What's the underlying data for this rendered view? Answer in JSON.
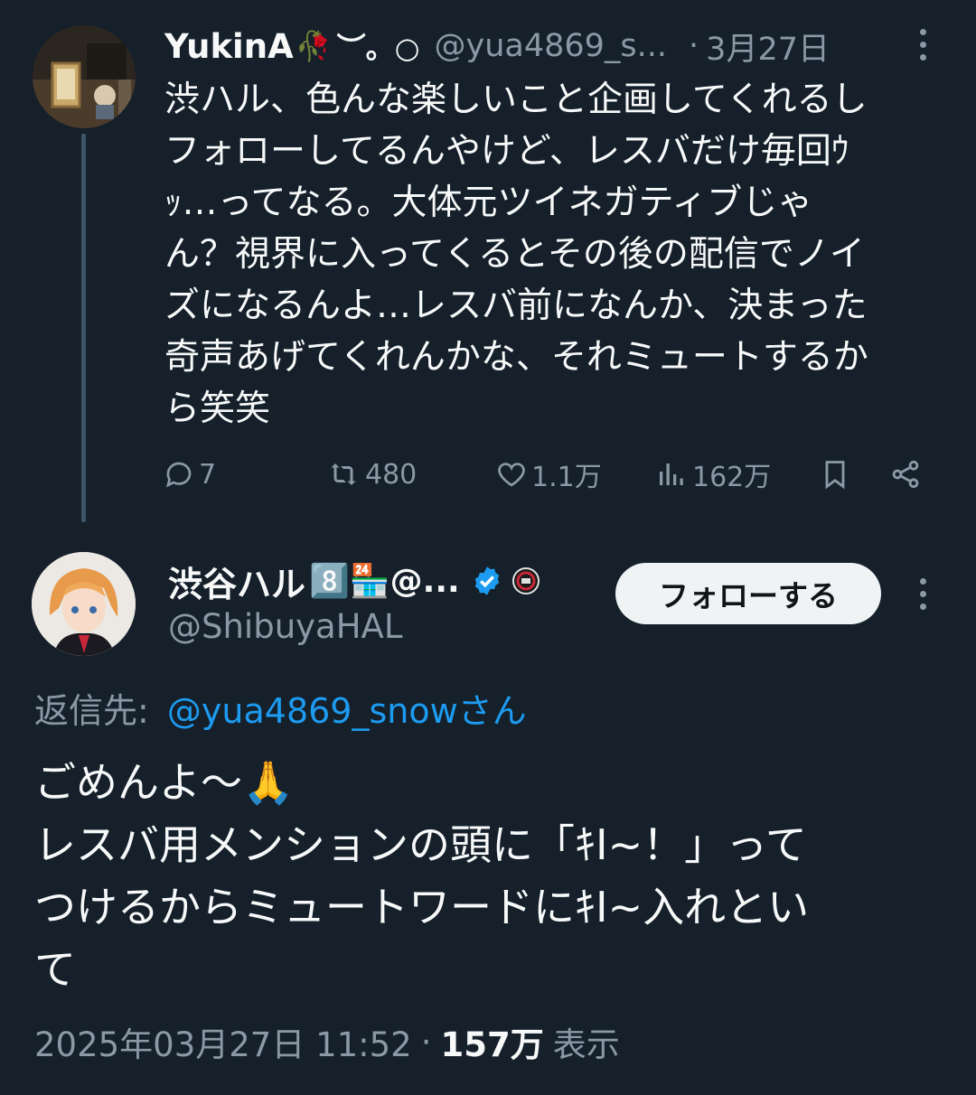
{
  "parent_tweet": {
    "display_name": "YukinA",
    "name_emoji": "🥀",
    "name_suffix": "︶。○",
    "handle": "@yua4869_s...",
    "separator": "·",
    "date": "3月27日",
    "text": "渋ハル、色んな楽しいこと企画してくれるし\nフォローしてるんやけど、レスバだけ毎回ｳ\nｯ…ってなる。大体元ツイネガティブじゃ\nん？視界に入ってくるとその後の配信でノイ\nズになるんよ…レスバ前になんか、決まった\n奇声あげてくれんかな、それミュートするか\nら笑笑",
    "stats": {
      "replies": "7",
      "retweets": "480",
      "likes": "1.1万",
      "views": "162万"
    }
  },
  "main_tweet": {
    "display_name": "渋谷ハル",
    "name_emojis": "8️⃣🏪@...",
    "handle": "@ShibuyaHAL",
    "follow_label": "フォローする",
    "reply_prefix": "返信先:",
    "reply_to": "@yua4869_snowさん",
    "text": "ごめんよ〜🙏\nレスバ用メンションの頭に「ｷI~！」って\nつけるからミュートワードにｷI~入れとい\nて",
    "timestamp": "2025年03月27日 11:52",
    "dot": "·",
    "views_count": "157万",
    "views_label": "表示"
  },
  "colors": {
    "background": "#15202b",
    "text": "#f7f9f9",
    "muted": "#8b98a5",
    "link": "#1d9bf0",
    "verified": "#1d9bf0"
  }
}
